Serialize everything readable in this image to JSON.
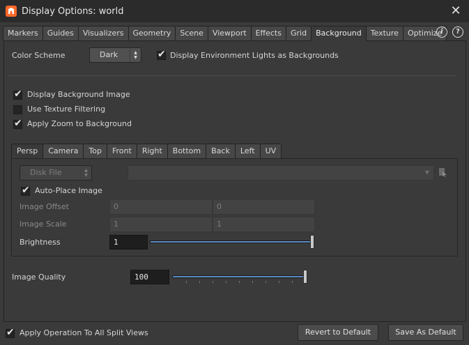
{
  "window": {
    "title": "Display Options:  world"
  },
  "tabs": [
    "Markers",
    "Guides",
    "Visualizers",
    "Geometry",
    "Scene",
    "Viewport",
    "Effects",
    "Grid",
    "Background",
    "Texture",
    "Optimize"
  ],
  "active_tab": "Background",
  "top_controls": {
    "color_scheme_label": "Color Scheme",
    "color_scheme_value": "Dark",
    "env_lights_label": "Display Environment Lights as Backgrounds"
  },
  "options": {
    "display_bg_image": "Display Background Image",
    "texture_filtering": "Use Texture Filtering",
    "apply_zoom": "Apply Zoom to Background"
  },
  "view_tabs": [
    "Persp",
    "Camera",
    "Top",
    "Front",
    "Right",
    "Bottom",
    "Back",
    "Left",
    "UV"
  ],
  "active_view_tab": "Persp",
  "source": {
    "type_value": "Disk File",
    "auto_place_label": "Auto-Place Image",
    "image_offset_label": "Image Offset",
    "image_offset": [
      "0",
      "0"
    ],
    "image_scale_label": "Image Scale",
    "image_scale": [
      "1",
      "1"
    ],
    "brightness_label": "Brightness",
    "brightness_value": "1",
    "brightness_fraction": 1.0
  },
  "quality": {
    "label": "Image Quality",
    "value": "100",
    "fraction": 1.0
  },
  "footer": {
    "apply_all_label": "Apply Operation To All Split Views",
    "revert_label": "Revert to Default",
    "save_label": "Save As Default"
  },
  "colors": {
    "accent_orange": "#ff6a2b",
    "slider_blue": "#5d8bc4"
  }
}
